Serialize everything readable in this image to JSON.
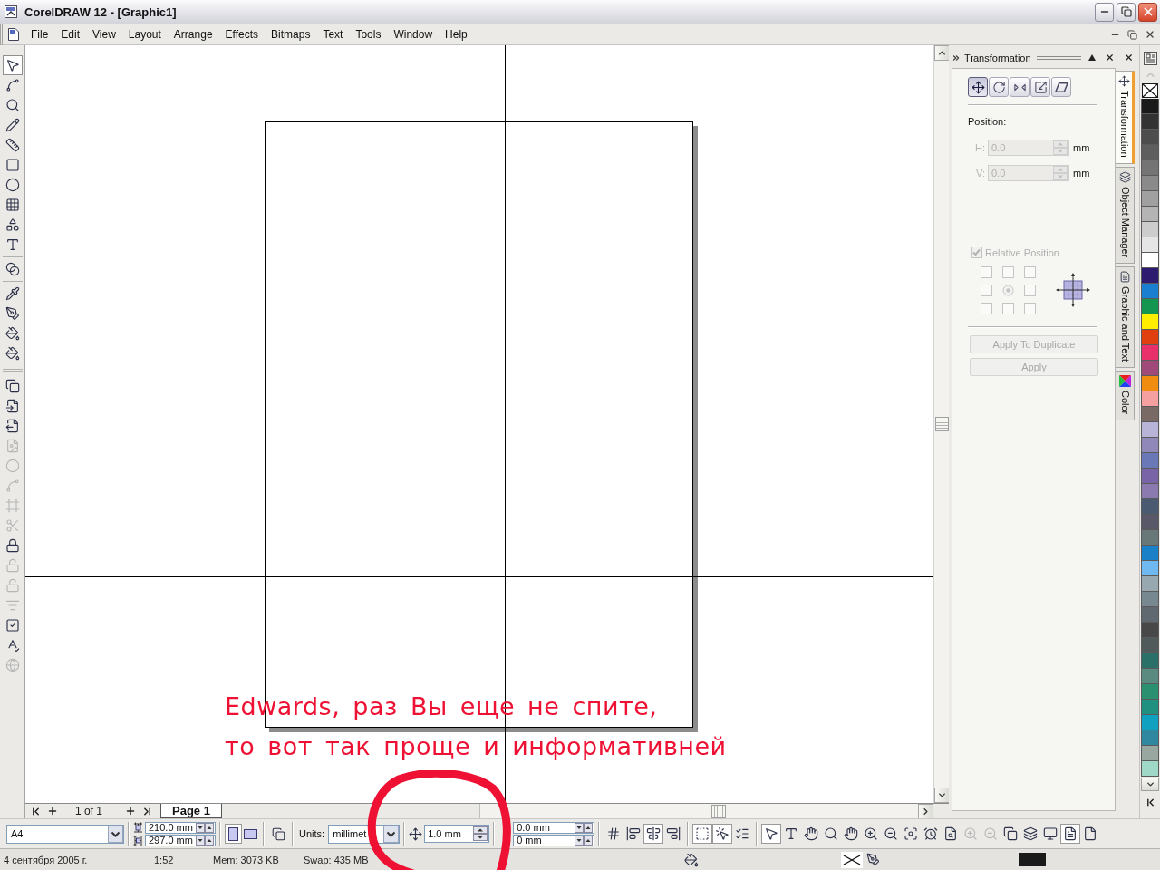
{
  "window": {
    "title": "CorelDRAW 12 - [Graphic1]"
  },
  "menu": [
    "File",
    "Edit",
    "View",
    "Layout",
    "Arrange",
    "Effects",
    "Bitmaps",
    "Text",
    "Tools",
    "Window",
    "Help"
  ],
  "toolbox": {
    "groups": [
      {
        "tools": [
          {
            "kind": "pick",
            "selected": true,
            "disabled": false
          },
          {
            "kind": "shape",
            "selected": false,
            "disabled": false
          },
          {
            "kind": "zoom",
            "selected": false,
            "disabled": false
          },
          {
            "kind": "freehand",
            "selected": false,
            "disabled": false
          },
          {
            "kind": "dimension",
            "selected": false,
            "disabled": false
          },
          {
            "kind": "rectangle",
            "selected": false,
            "disabled": false
          },
          {
            "kind": "ellipse",
            "selected": false,
            "disabled": false
          },
          {
            "kind": "graph",
            "selected": false,
            "disabled": false
          },
          {
            "kind": "shapes",
            "selected": false,
            "disabled": false
          },
          {
            "kind": "text",
            "selected": false,
            "disabled": false
          }
        ]
      },
      {
        "tools": [
          {
            "kind": "blend",
            "selected": false,
            "disabled": false
          }
        ]
      },
      {
        "tools": [
          {
            "kind": "eyedropper",
            "selected": false,
            "disabled": false
          },
          {
            "kind": "outline",
            "selected": false,
            "disabled": false
          },
          {
            "kind": "fill",
            "selected": false,
            "disabled": false
          },
          {
            "kind": "interactive",
            "selected": false,
            "disabled": false
          }
        ]
      },
      {
        "tools": [
          {
            "kind": "stack",
            "selected": false,
            "disabled": false
          },
          {
            "kind": "page_in",
            "selected": false,
            "disabled": false
          },
          {
            "kind": "page_out",
            "selected": false,
            "disabled": false
          },
          {
            "kind": "convert",
            "selected": false,
            "disabled": true
          },
          {
            "kind": "circle",
            "selected": false,
            "disabled": true
          },
          {
            "kind": "curve",
            "selected": false,
            "disabled": true
          },
          {
            "kind": "frame",
            "selected": false,
            "disabled": true
          },
          {
            "kind": "cut",
            "selected": false,
            "disabled": true
          },
          {
            "kind": "lock",
            "selected": false,
            "disabled": false
          },
          {
            "kind": "unlock",
            "selected": false,
            "disabled": true
          },
          {
            "kind": "unlock",
            "selected": false,
            "disabled": true
          },
          {
            "kind": "filter",
            "selected": false,
            "disabled": true
          },
          {
            "kind": "check",
            "selected": false,
            "disabled": false
          },
          {
            "kind": "spell",
            "selected": false,
            "disabled": false
          },
          {
            "kind": "globe",
            "selected": false,
            "disabled": true
          }
        ]
      }
    ]
  },
  "canvas": {
    "annotation": [
      "Edwards, раз Вы еще не спите,",
      "то вот так проще и информативней"
    ]
  },
  "page_navigator": {
    "counter": "1 of 1",
    "tabs": [
      {
        "label": "Page 1",
        "selected": true
      }
    ]
  },
  "docker": {
    "title": "Transformation",
    "modes": [
      {
        "kind": "position",
        "selected": true
      },
      {
        "kind": "rotate",
        "selected": false
      },
      {
        "kind": "scale",
        "selected": false
      },
      {
        "kind": "size",
        "selected": false
      },
      {
        "kind": "skew",
        "selected": false
      }
    ],
    "section": "Position:",
    "fields": [
      {
        "label": "H:",
        "value": "0.0",
        "unit": "mm",
        "disabled": true
      },
      {
        "label": "V:",
        "value": "0.0",
        "unit": "mm",
        "disabled": true
      }
    ],
    "relative_position": {
      "label": "Relative Position",
      "checked": true,
      "disabled": true
    },
    "anchors": [
      {
        "selected": false
      },
      {
        "selected": false
      },
      {
        "selected": false
      },
      {
        "selected": false
      },
      {
        "selected": true
      },
      {
        "selected": false
      },
      {
        "selected": false
      },
      {
        "selected": false
      },
      {
        "selected": false
      }
    ],
    "buttons": [
      {
        "label": "Apply To Duplicate",
        "disabled": true
      },
      {
        "label": "Apply",
        "disabled": true
      }
    ],
    "tabs": [
      {
        "kind": "transform",
        "label": "Transformation",
        "selected": true
      },
      {
        "kind": "objects",
        "label": "Object Manager",
        "selected": false
      },
      {
        "kind": "graphic_text",
        "label": "Graphic and Text",
        "selected": false
      },
      {
        "kind": "color",
        "label": "Color",
        "selected": false
      }
    ]
  },
  "palette": {
    "swatches": [
      {
        "color": "#1a1a1a"
      },
      {
        "color": "#333333"
      },
      {
        "color": "#4d4d4d"
      },
      {
        "color": "#5e5e5e"
      },
      {
        "color": "#747474"
      },
      {
        "color": "#8a8a8a"
      },
      {
        "color": "#a0a0a0"
      },
      {
        "color": "#b4b4b4"
      },
      {
        "color": "#cccccc"
      },
      {
        "color": "#e5e5e5"
      },
      {
        "color": "#ffffff"
      },
      {
        "color": "#2e1a6e"
      },
      {
        "color": "#1a7fd0"
      },
      {
        "color": "#149650"
      },
      {
        "color": "#ffee00"
      },
      {
        "color": "#e04010"
      },
      {
        "color": "#e8306a"
      },
      {
        "color": "#a04a7a"
      },
      {
        "color": "#f08c10"
      },
      {
        "color": "#f4a0a0"
      },
      {
        "color": "#7a6a66"
      },
      {
        "color": "#b8b4d8"
      },
      {
        "color": "#9088b8"
      },
      {
        "color": "#6a78b8"
      },
      {
        "color": "#7a64a8"
      },
      {
        "color": "#8a7ab0"
      },
      {
        "color": "#4a5a70"
      },
      {
        "color": "#585868"
      },
      {
        "color": "#687878"
      },
      {
        "color": "#1a80c8"
      },
      {
        "color": "#70b8f0"
      },
      {
        "color": "#98a8b0"
      },
      {
        "color": "#788890"
      },
      {
        "color": "#606870"
      },
      {
        "color": "#484848"
      },
      {
        "color": "#505a5a"
      },
      {
        "color": "#2a7068"
      },
      {
        "color": "#5a8a80"
      },
      {
        "color": "#2a9070"
      },
      {
        "color": "#209080"
      },
      {
        "color": "#10a0c0"
      },
      {
        "color": "#3088a0"
      },
      {
        "color": "#98a8a0"
      },
      {
        "color": "#a0d8c8"
      }
    ]
  },
  "property_bar": {
    "paper_size": "A4",
    "page_width": "210.0 mm",
    "page_height": "297.0 mm",
    "orientation": [
      {
        "kind": "portrait",
        "selected": true
      },
      {
        "kind": "landscape",
        "selected": false
      }
    ],
    "units_label": "Units:",
    "units": "millimet",
    "nudge": "1.0 mm",
    "duplicate_distance": [
      "0.0 mm",
      "0 mm"
    ],
    "tool_groups": [
      {
        "buttons": [
          {
            "kind": "grid",
            "selected": false,
            "disabled": false
          },
          {
            "kind": "align_left",
            "selected": false,
            "disabled": false
          },
          {
            "kind": "align_center",
            "selected": true,
            "disabled": false
          },
          {
            "kind": "align_right",
            "selected": false,
            "disabled": false
          }
        ]
      },
      {
        "buttons": [
          {
            "kind": "select_area",
            "selected": true,
            "disabled": false
          },
          {
            "kind": "select_pointer",
            "selected": true,
            "disabled": false
          },
          {
            "kind": "list",
            "selected": false,
            "disabled": false
          }
        ]
      },
      {
        "buttons": [
          {
            "kind": "pick",
            "selected": true,
            "disabled": false
          },
          {
            "kind": "font",
            "selected": false,
            "disabled": false
          },
          {
            "kind": "hand",
            "selected": false,
            "disabled": false
          },
          {
            "kind": "zoom_one",
            "selected": false,
            "disabled": false
          },
          {
            "kind": "hand_one",
            "selected": false,
            "disabled": false
          },
          {
            "kind": "zoom_in",
            "selected": false,
            "disabled": false
          },
          {
            "kind": "zoom_out",
            "selected": false,
            "disabled": false
          },
          {
            "kind": "zoom_height",
            "selected": false,
            "disabled": false
          },
          {
            "kind": "zoom_alarm",
            "selected": false,
            "disabled": false
          },
          {
            "kind": "zoom_page",
            "selected": false,
            "disabled": false
          },
          {
            "kind": "zoom_selected",
            "selected": false,
            "disabled": true
          },
          {
            "kind": "zoom_all",
            "selected": false,
            "disabled": true
          },
          {
            "kind": "copy",
            "selected": false,
            "disabled": false
          },
          {
            "kind": "layers",
            "selected": false,
            "disabled": false
          },
          {
            "kind": "monitor",
            "selected": false,
            "disabled": false
          },
          {
            "kind": "doc_star",
            "selected": true,
            "disabled": false
          },
          {
            "kind": "doc",
            "selected": false,
            "disabled": false
          }
        ]
      }
    ]
  },
  "status_bar": {
    "date": "4 сентября 2005 г.",
    "time": "1:52",
    "memory": "Mem: 3073 KB",
    "swap": "Swap: 435 MB"
  }
}
